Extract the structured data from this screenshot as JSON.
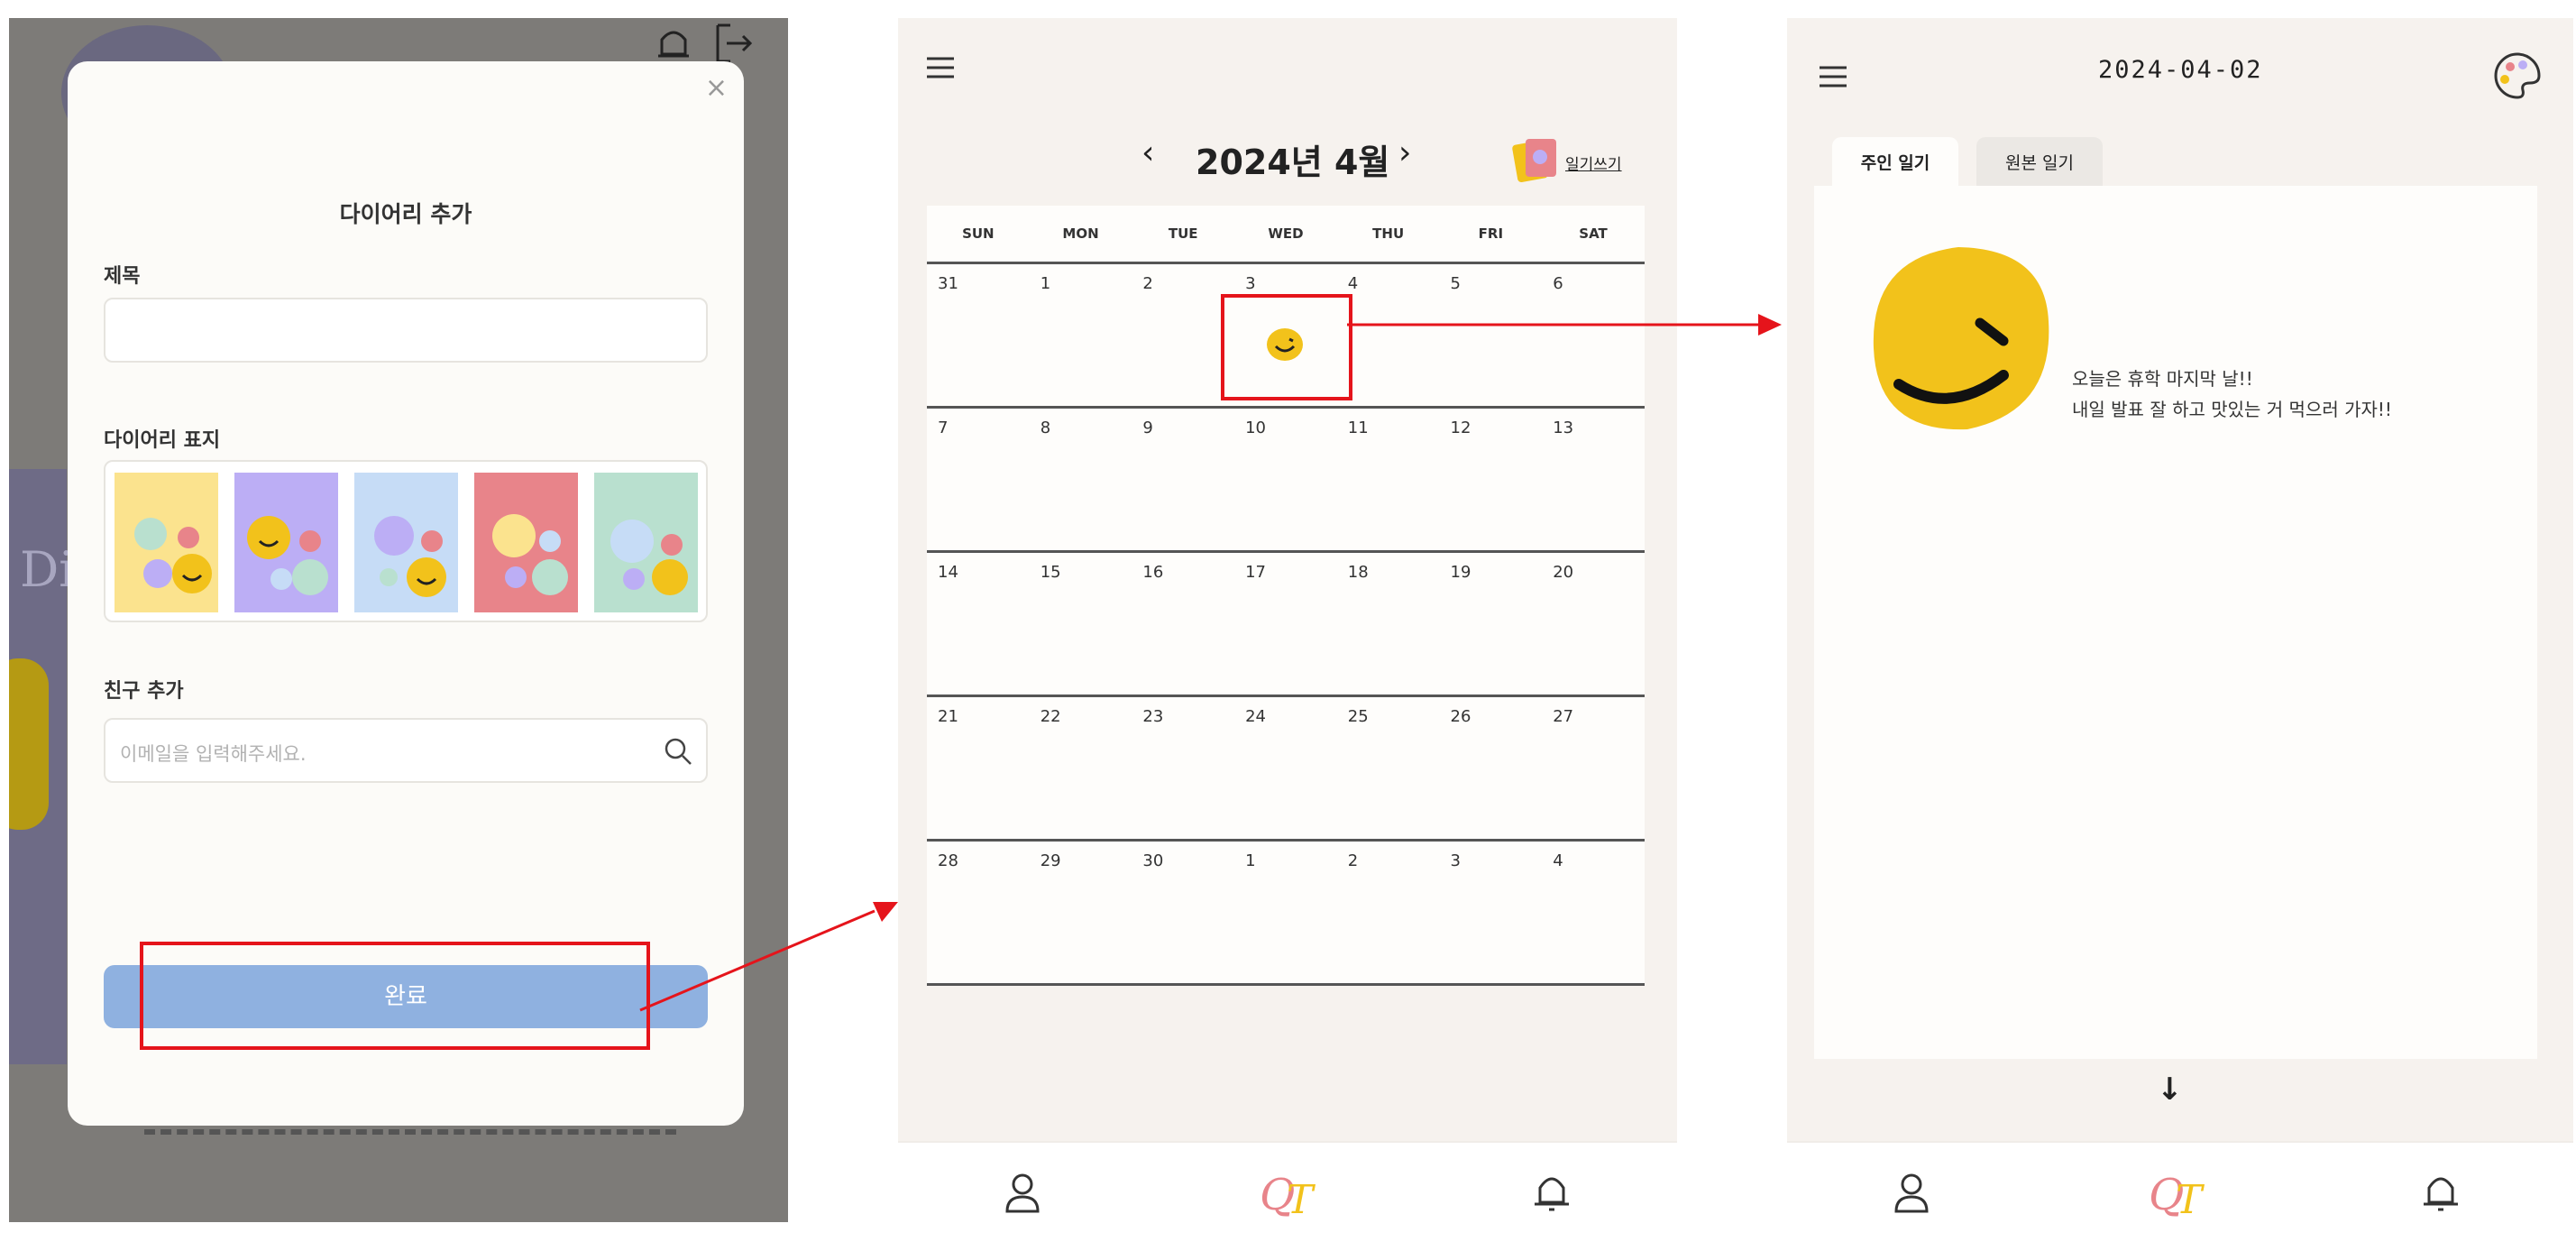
{
  "modal": {
    "close": "×",
    "title": "다이어리 추가",
    "title_label": "제목",
    "title_value": "",
    "cover_label": "다이어리 표지",
    "covers": [
      {
        "icon": "emoji-cover-yellow",
        "color": "#fbe38e"
      },
      {
        "icon": "emoji-cover-purple",
        "color": "#bcaef5"
      },
      {
        "icon": "emoji-cover-blue",
        "color": "#c6dcf6"
      },
      {
        "icon": "emoji-cover-red",
        "color": "#e8848a"
      },
      {
        "icon": "emoji-cover-green",
        "color": "#b9e0cf"
      }
    ],
    "friend_label": "친구 추가",
    "friend_placeholder": "이메일을 입력해주세요.",
    "done_button": "완료",
    "done_color": "#8fb1e0"
  },
  "calendar": {
    "prev": "‹",
    "title": "2024년 4월",
    "next": "›",
    "diary_view": "일기쓰기",
    "weekdays": [
      "SUN",
      "MON",
      "TUE",
      "WED",
      "THU",
      "FRI",
      "SAT"
    ],
    "weeks": [
      [
        "31",
        "1",
        "2",
        "3",
        "4",
        "5",
        "6"
      ],
      [
        "7",
        "8",
        "9",
        "10",
        "11",
        "12",
        "13"
      ],
      [
        "14",
        "15",
        "16",
        "17",
        "18",
        "19",
        "20"
      ],
      [
        "21",
        "22",
        "23",
        "24",
        "25",
        "26",
        "27"
      ],
      [
        "28",
        "29",
        "30",
        "1",
        "2",
        "3",
        "4"
      ]
    ],
    "marked_day": {
      "week": 0,
      "day": 3,
      "icon": "smile-face-icon"
    }
  },
  "diary": {
    "date": "2024-04-02",
    "tabs": [
      "주인 일기",
      "원본 일기"
    ],
    "active_tab": 0,
    "lines": [
      "오늘은 휴학 마지막 날!!",
      "내일 발표 잘 하고 맛있는 거 먹으러 가자!!"
    ],
    "scroll_down": "↓"
  },
  "nav": {
    "profile_icon": "person-icon",
    "home_icon": "qt-logo",
    "home_text": "QT",
    "bell_icon": "bell-icon"
  },
  "colors": {
    "highlight": "#e5141b",
    "smile_face": "#f2c21b",
    "panel_bg": "#f6f2ee"
  }
}
